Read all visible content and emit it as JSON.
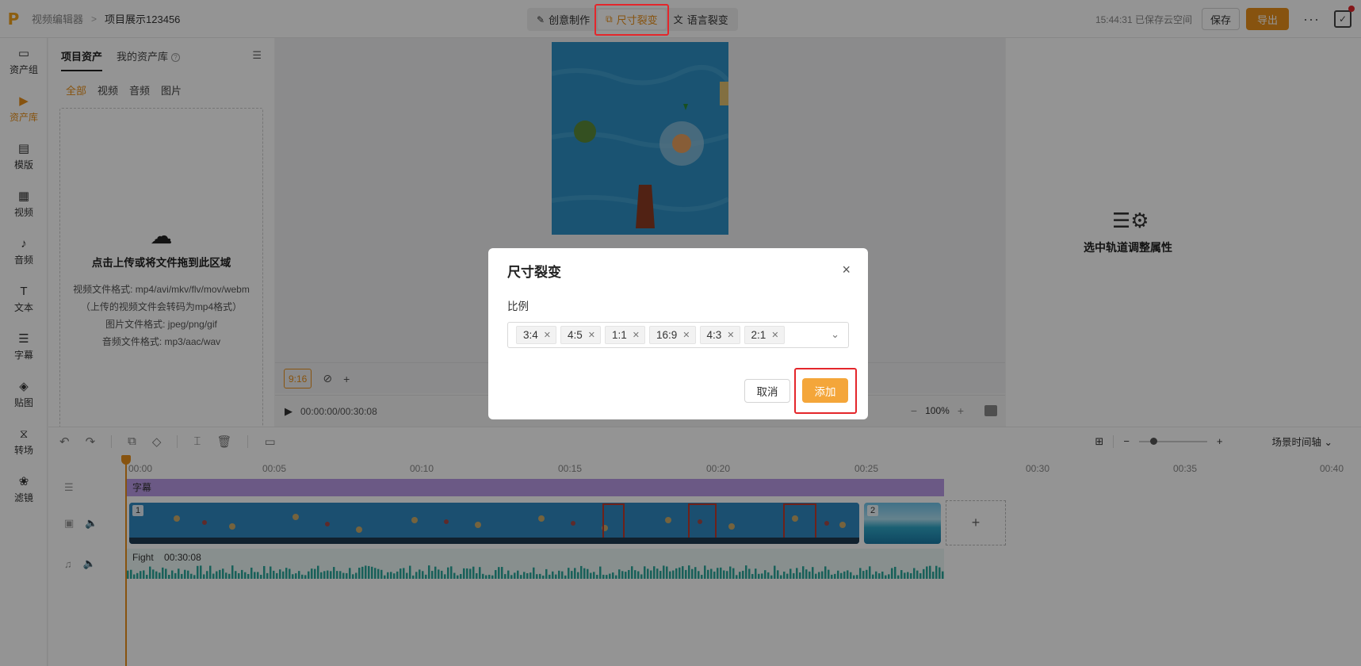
{
  "topbar": {
    "logo": "P",
    "breadcrumb_app": "视频编辑器",
    "breadcrumb_sep": ">",
    "project_name": "项目展示123456",
    "modes": [
      {
        "label": "创意制作",
        "icon": "creative-icon"
      },
      {
        "label": "尺寸裂变",
        "icon": "resize-icon"
      },
      {
        "label": "语言裂变",
        "icon": "translate-icon"
      }
    ],
    "save_status": "15:44:31 已保存云空间",
    "save_label": "保存",
    "export_label": "导出",
    "more": "···"
  },
  "rail": {
    "items": [
      {
        "label": "资产组",
        "icon": "folder-icon"
      },
      {
        "label": "资产库",
        "icon": "media-library-icon"
      },
      {
        "label": "模版",
        "icon": "template-icon"
      },
      {
        "label": "视频",
        "icon": "film-icon"
      },
      {
        "label": "音频",
        "icon": "music-icon"
      },
      {
        "label": "文本",
        "icon": "text-icon"
      },
      {
        "label": "字幕",
        "icon": "subtitle-icon"
      },
      {
        "label": "贴图",
        "icon": "sticker-icon"
      },
      {
        "label": "转场",
        "icon": "transition-icon"
      },
      {
        "label": "滤镜",
        "icon": "filter-icon"
      }
    ],
    "active_index": 1
  },
  "assets": {
    "tab_project": "项目资产",
    "tab_mine": "我的资产库",
    "help": "?",
    "filters": [
      "全部",
      "视频",
      "音频",
      "图片"
    ],
    "upload_title": "点击上传或将文件拖到此区域",
    "upload_lines": [
      "视频文件格式: mp4/avi/mkv/flv/mov/webm",
      "（上传的视频文件会转码为mp4格式）",
      "图片文件格式: jpeg/png/gif",
      "音频文件格式: mp3/aac/wav"
    ]
  },
  "preview": {
    "ratio": "9:16",
    "timecode": "00:00:00/00:30:08",
    "zoom": "100%",
    "minus": "−",
    "plus": "+"
  },
  "props": {
    "hint": "选中轨道调整属性"
  },
  "timeline": {
    "view_mode": "场景时间轴",
    "ruler": [
      "00:00",
      "00:05",
      "00:10",
      "00:15",
      "00:20",
      "00:25",
      "00:30",
      "00:35",
      "00:40"
    ],
    "subtitle_label": "字幕",
    "clip1_index": "1",
    "clip2_index": "2",
    "audio_name": "Fight",
    "audio_duration": "00:30:08"
  },
  "modal": {
    "title": "尺寸裂变",
    "field_label": "比例",
    "tags": [
      "3:4",
      "4:5",
      "1:1",
      "16:9",
      "4:3",
      "2:1"
    ],
    "cancel": "取消",
    "confirm": "添加",
    "close": "×"
  },
  "colors": {
    "accent": "#e8901a",
    "highlight": "#e4262b",
    "subtitle_track": "#b99ae5",
    "video_bg": "#2d8cc0"
  }
}
